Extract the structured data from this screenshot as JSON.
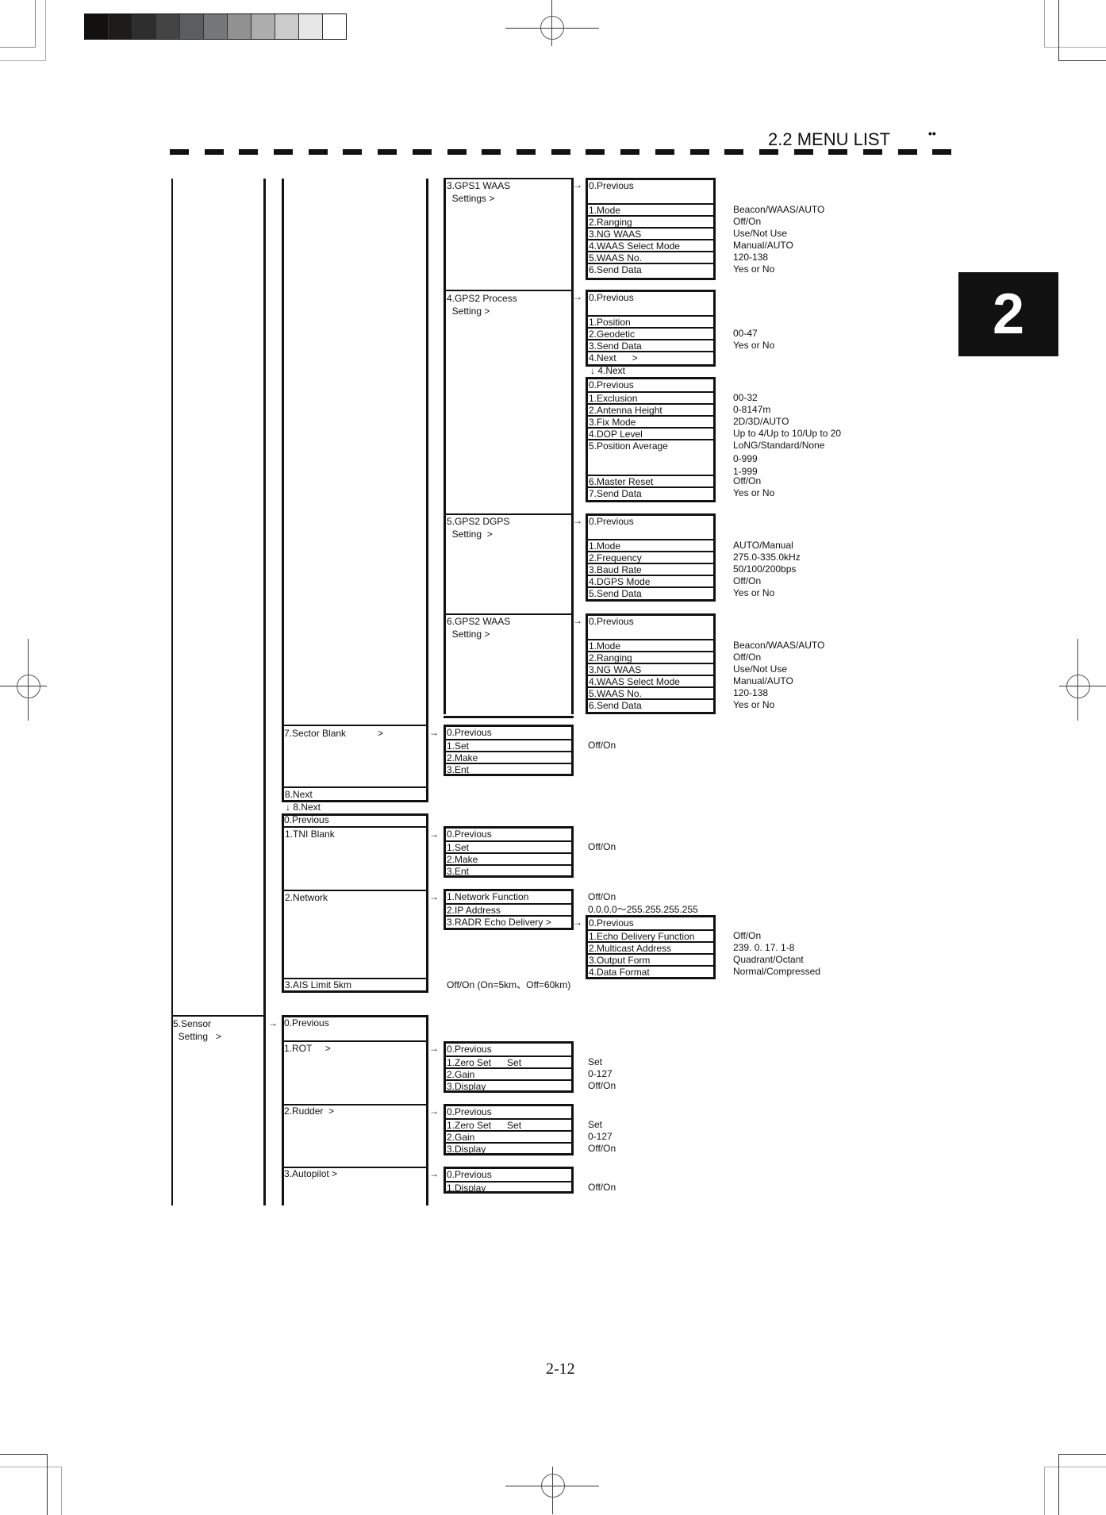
{
  "header": {
    "section_title": "2.2 MENU LIST",
    "bullets": "••",
    "chapter_tab": "2"
  },
  "footer": {
    "page_number": "2-12"
  },
  "calibration_strip": {
    "grays": [
      "#121110",
      "#1d1c1b",
      "#2e2e2e",
      "#444444",
      "#5c5d5f",
      "#767779",
      "#919191",
      "#adadad",
      "#cbcbcb",
      "#e7e7e7",
      "#ffffff"
    ]
  },
  "arrow_glyph": "→",
  "down_arrow_glyph": "↓",
  "gps1_waas": {
    "parent": [
      "3.GPS1 WAAS",
      "  Settings >"
    ],
    "items": [
      "0.Previous",
      "1.Mode",
      "2.Ranging",
      "3.NG WAAS",
      "4.WAAS Select Mode",
      "5.WAAS No.",
      "6.Send Data"
    ],
    "values": [
      "",
      "Beacon/WAAS/AUTO",
      "Off/On",
      "Use/Not Use",
      "Manual/AUTO",
      "120-138",
      "Yes or No"
    ]
  },
  "gps2_process": {
    "parent": [
      "4.GPS2 Process",
      "  Setting >"
    ],
    "items": [
      "0.Previous",
      "1.Position",
      "2.Geodetic",
      "3.Send Data",
      "4.Next      >"
    ],
    "values": [
      "",
      "",
      "00-47",
      "Yes or No",
      ""
    ],
    "next_label": "↓ 4.Next",
    "next_items": [
      "0.Previous",
      "1.Exclusion",
      "2.Antenna Height",
      "3.Fix Mode",
      "4.DOP Level",
      "5.Position Average",
      "6.Master Reset",
      "7.Send Data"
    ],
    "next_values": [
      "",
      "00-32",
      "0-8147m",
      "2D/3D/AUTO",
      "Up to 4/Up to 10/Up to 20",
      "LoNG/Standard/None",
      "Off/On",
      "Yes or No"
    ],
    "position_average_extra": [
      "0-999",
      "1-999"
    ]
  },
  "gps2_dgps": {
    "parent": [
      "5.GPS2 DGPS",
      "  Setting  >"
    ],
    "items": [
      "0.Previous",
      "1.Mode",
      "2.Frequency",
      "3.Baud Rate",
      "4.DGPS Mode",
      "5.Send Data"
    ],
    "values": [
      "",
      "AUTO/Manual",
      "275.0-335.0kHz",
      "50/100/200bps",
      "Off/On",
      "Yes or No"
    ]
  },
  "gps2_waas": {
    "parent": [
      "6.GPS2 WAAS",
      "  Setting >"
    ],
    "items": [
      "0.Previous",
      "1.Mode",
      "2.Ranging",
      "3.NG WAAS",
      "4.WAAS Select Mode",
      "5.WAAS No.",
      "6.Send Data"
    ],
    "values": [
      "",
      "Beacon/WAAS/AUTO",
      "Off/On",
      "Use/Not Use",
      "Manual/AUTO",
      "120-138",
      "Yes or No"
    ]
  },
  "sector_blank": {
    "parent": "7.Sector Blank            >",
    "items": [
      "0.Previous",
      "1.Set",
      "2.Make",
      "3.Ent"
    ],
    "values": [
      "",
      "Off/On",
      "",
      ""
    ]
  },
  "next8": {
    "item": "8.Next",
    "label": "↓ 8.Next",
    "previous": "0.Previous"
  },
  "tni_blank": {
    "parent": "1.TNI Blank",
    "items": [
      "0.Previous",
      "1.Set",
      "2.Make",
      "3.Ent"
    ],
    "values": [
      "",
      "Off/On",
      "",
      ""
    ]
  },
  "network": {
    "parent": "2.Network",
    "items": [
      "1.Network Function",
      "2.IP Address",
      "3.RADR Echo Delivery >"
    ],
    "values": [
      "Off/On",
      "0.0.0.0～255.255.255.255",
      ""
    ],
    "echo_items": [
      "0.Previous",
      "1.Echo Delivery Function",
      "2.Multicast Address",
      "3.Output Form",
      "4.Data Format"
    ],
    "echo_values": [
      "",
      "Off/On",
      "239. 0. 17. 1-8",
      "Quadrant/Octant",
      "Normal/Compressed"
    ]
  },
  "ais_limit": {
    "item": "3.AIS Limit 5km",
    "value": "Off/On (On=5km、Off=60km)"
  },
  "sensor": {
    "parent": [
      "5.Sensor",
      "  Setting   >"
    ],
    "previous": "0.Previous",
    "rot": {
      "parent": "1.ROT     >",
      "items": [
        "0.Previous",
        "1.Zero Set      Set",
        "2.Gain",
        "3.Display"
      ],
      "values": [
        "",
        "Set",
        "0-127",
        "Off/On"
      ]
    },
    "rudder": {
      "parent": "2.Rudder  >",
      "items": [
        "0.Previous",
        "1.Zero Set      Set",
        "2.Gain",
        "3.Display"
      ],
      "values": [
        "",
        "Set",
        "0-127",
        "Off/On"
      ]
    },
    "autopilot": {
      "parent": "3.Autopilot >",
      "items": [
        "0.Previous",
        "1.Display"
      ],
      "values": [
        "",
        "Off/On"
      ]
    }
  }
}
